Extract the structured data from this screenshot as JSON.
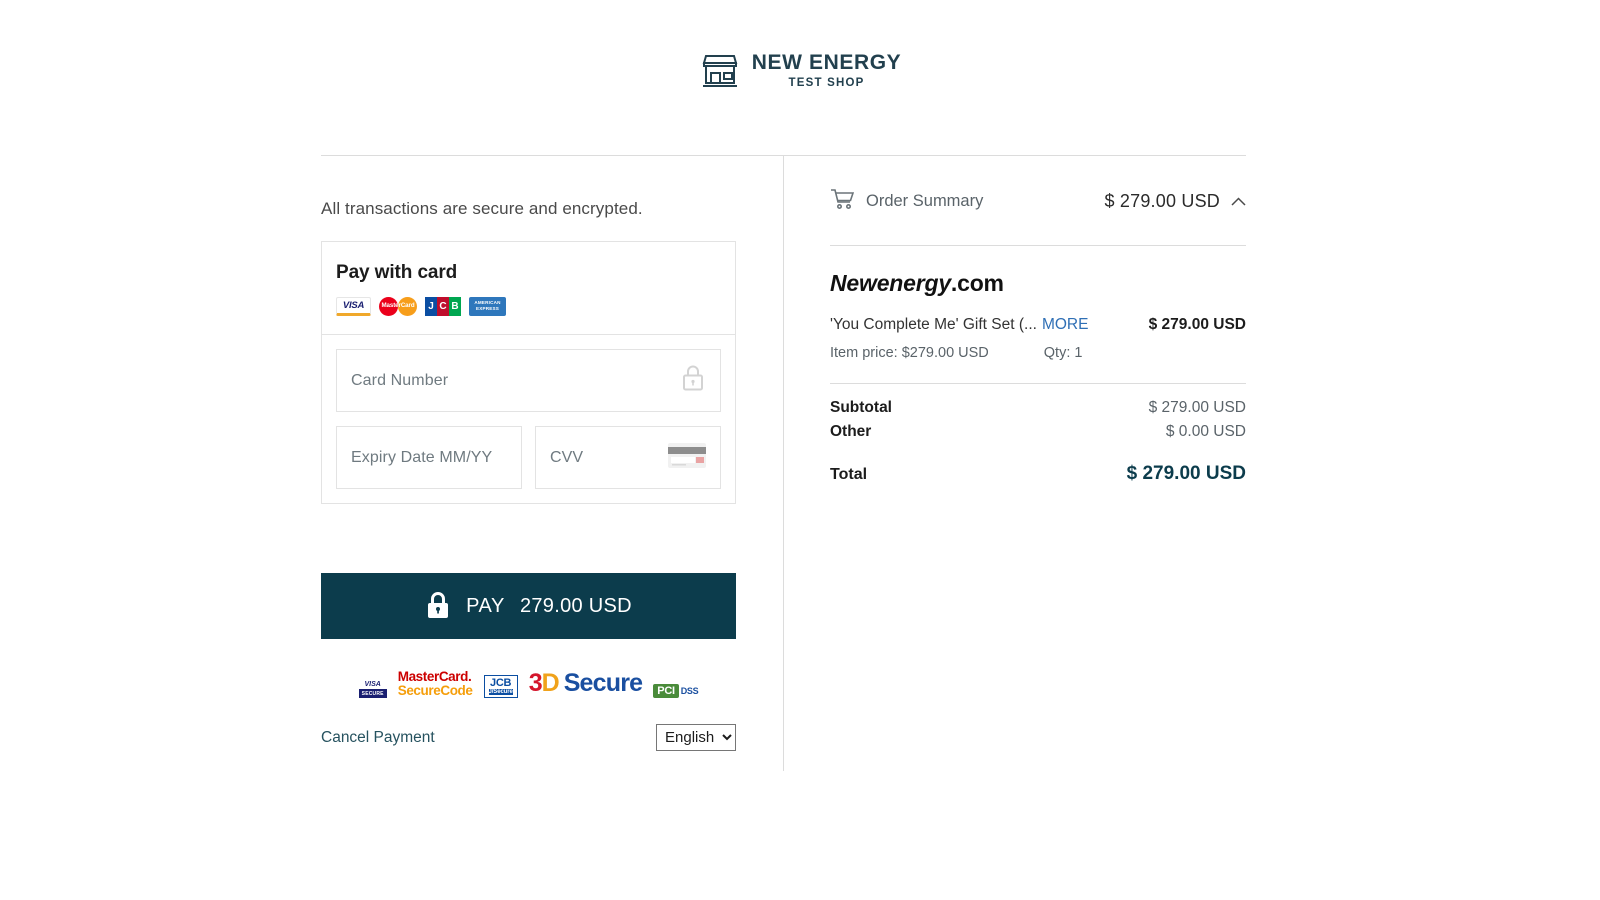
{
  "header": {
    "brand_name": "NEW ENERGY",
    "brand_sub": "TEST SHOP",
    "icon": "storefront-icon"
  },
  "left": {
    "secure_note": "All transactions are secure and encrypted.",
    "pay_with_card_title": "Pay with card",
    "accepted_cards": [
      {
        "name": "visa",
        "label": "VISA"
      },
      {
        "name": "mastercard",
        "label": "MasterCard"
      },
      {
        "name": "jcb",
        "label": "JCB"
      },
      {
        "name": "amex",
        "label": "AMERICAN EXPRESS"
      }
    ],
    "amex_line1": "AMERICAN",
    "amex_line2": "EXPRESS",
    "jcb_j": "J",
    "jcb_c": "C",
    "jcb_b": "B",
    "mastercard_label": "MasterCard",
    "visa_label": "VISA",
    "fields": {
      "card_number_placeholder": "Card Number",
      "card_number_value": "",
      "expiry_placeholder": "Expiry Date MM/YY",
      "expiry_value": "",
      "cvv_placeholder": "CVV",
      "cvv_value": "",
      "card_number_icon": "lock-icon",
      "cvv_icon": "card-back-icon"
    },
    "pay_button": {
      "icon": "lock-icon",
      "label": "PAY",
      "amount": "279.00 USD"
    },
    "badges": {
      "visa_line1": "VISA",
      "visa_line2": "SECURE",
      "mastercard_line1": "MasterCard.",
      "mastercard_line2": "SecureCode",
      "jcb_line1": "JCB",
      "jcb_line2": "J/Secure",
      "three_d_1": "3",
      "three_d_2": "D",
      "three_d_3": "Secure",
      "pci_1": "PCI",
      "pci_2": "DSS"
    },
    "cancel_label": "Cancel Payment",
    "language_selected": "English",
    "language_options": [
      "English"
    ]
  },
  "right": {
    "summary_icon": "cart-icon",
    "summary_title": "Order Summary",
    "summary_amount": "$ 279.00 USD",
    "collapse_icon": "chevron-up-icon",
    "merchant_name": "Newenergy",
    "merchant_tld": ".com",
    "item_name": "'You Complete Me' Gift Set (...",
    "item_more_label": "MORE",
    "item_price": "$ 279.00 USD",
    "item_unit_price": "Item price: $279.00 USD",
    "item_qty": "Qty: 1",
    "totals": [
      {
        "label": "Subtotal",
        "value": "$ 279.00 USD"
      },
      {
        "label": "Other",
        "value": "$ 0.00 USD"
      }
    ],
    "grand_total_label": "Total",
    "grand_total_value": "$ 279.00 USD"
  },
  "colors": {
    "accent_dark": "#0c3c4c",
    "link_blue": "#2f6fb5",
    "muted_text": "#5a6369"
  }
}
